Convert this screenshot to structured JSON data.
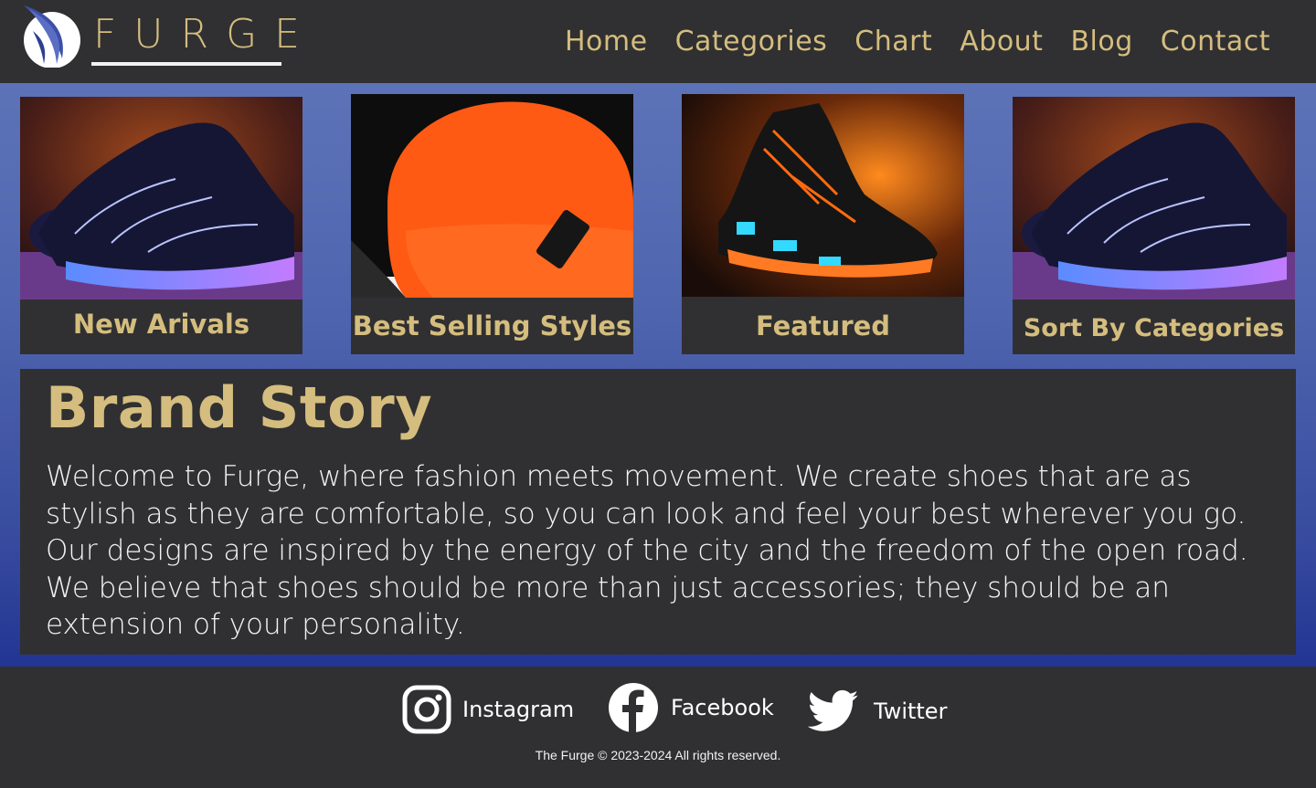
{
  "header": {
    "brand": "FURGE",
    "logo_icon": "feather-logo-icon",
    "nav": [
      "Home",
      "Categories",
      "Chart",
      "About",
      "Blog",
      "Contact"
    ]
  },
  "cards": [
    {
      "label": "New Arivals",
      "image": "glowing-purple-sneaker"
    },
    {
      "label": "Best Selling Styles",
      "image": "orange-beanie"
    },
    {
      "label": "Featured",
      "image": "black-orange-glow-sneaker"
    },
    {
      "label": "Sort By Categories",
      "image": "glowing-purple-sneaker"
    }
  ],
  "story": {
    "title": "Brand Story",
    "text": "Welcome to Furge, where fashion meets movement. We create shoes that are as stylish as they are comfortable, so you can look and feel your best wherever you go. Our designs are inspired by the energy of the city and the freedom of the open road. We believe that shoes should be more than just accessories; they should be an extension of your personality."
  },
  "footer": {
    "social": [
      {
        "label": "Instagram",
        "icon": "instagram-icon"
      },
      {
        "label": "Facebook",
        "icon": "facebook-icon"
      },
      {
        "label": "Twitter",
        "icon": "twitter-icon"
      }
    ],
    "copyright": "The Furge © 2023-2024 All rights reserved."
  },
  "colors": {
    "accent": "#d4bd7e",
    "panel": "#303032",
    "gradient_top": "#5d73b8",
    "gradient_bottom": "#223593"
  }
}
